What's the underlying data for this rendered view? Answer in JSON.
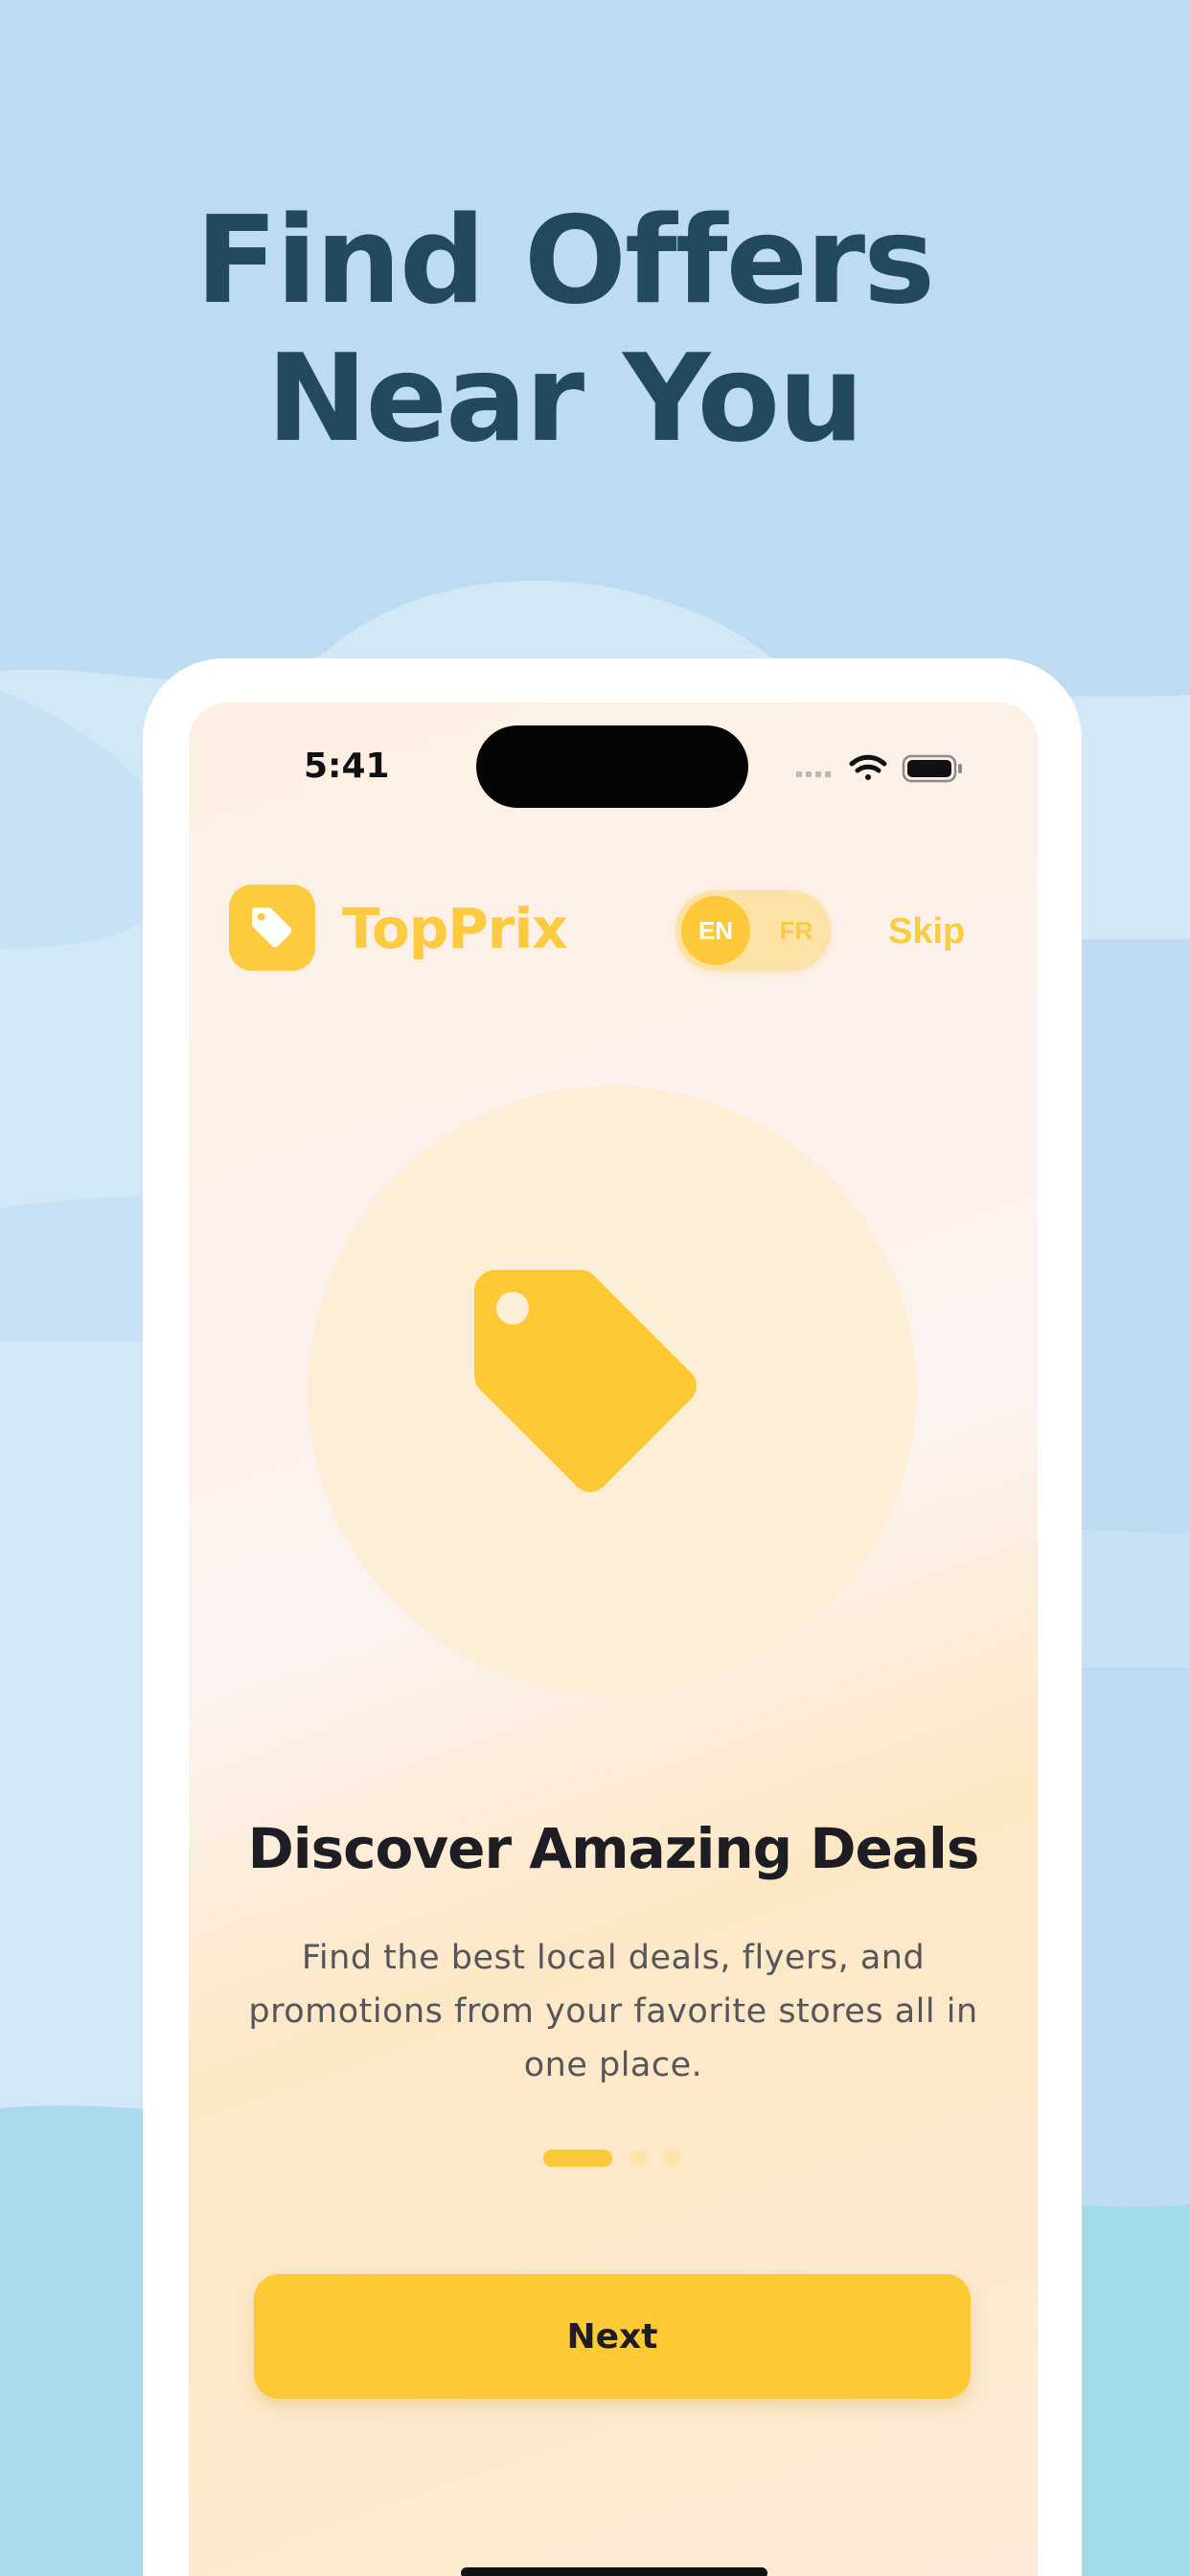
{
  "marketing": {
    "headline_line1": "Find Offers",
    "headline_line2": "Near You"
  },
  "status_bar": {
    "time": "5:41",
    "icons": [
      "signal-icon",
      "wifi-icon",
      "battery-icon"
    ]
  },
  "header": {
    "app_name": "TopPrix",
    "logo_icon": "price-tag-icon",
    "language": {
      "options": [
        "EN",
        "FR"
      ],
      "selected": "EN"
    },
    "skip_label": "Skip"
  },
  "onboarding": {
    "illustration_icon": "price-tag-icon",
    "title": "Discover Amazing Deals",
    "description": "Find the best local deals, flyers, and promotions from your favorite stores all in one place.",
    "page_count": 3,
    "current_page": 1,
    "next_label": "Next"
  },
  "colors": {
    "background": "#bddcf1",
    "headline": "#234a5c",
    "accent": "#fdcb3f",
    "title_text": "#1d1d23"
  }
}
